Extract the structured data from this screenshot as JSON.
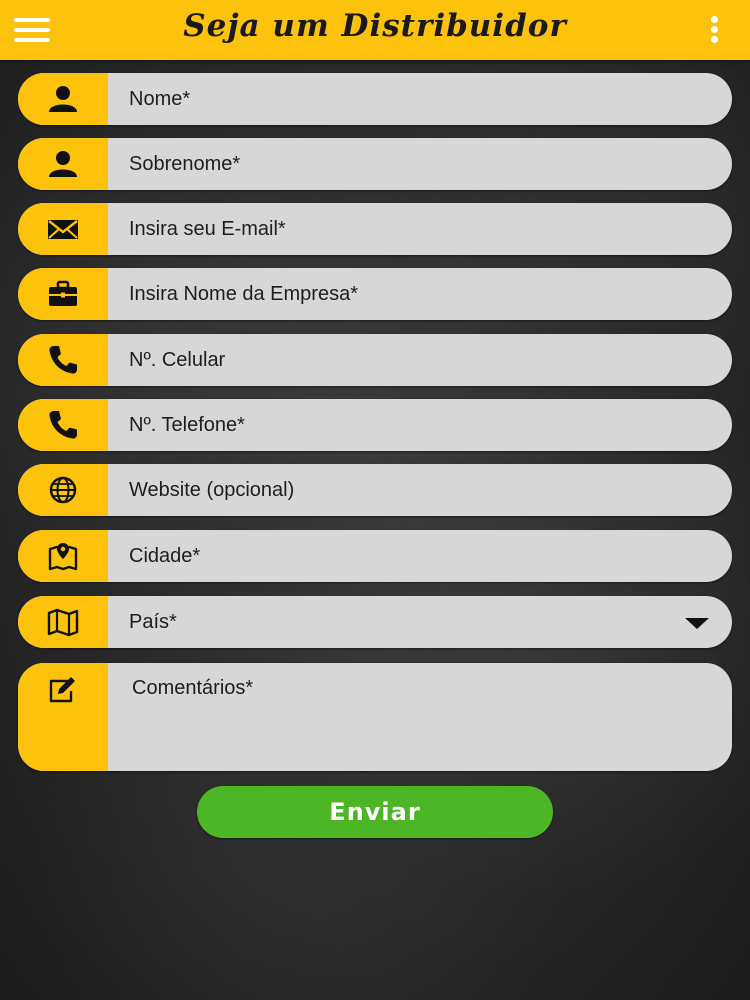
{
  "header": {
    "title": "Seja um Distribuidor",
    "menu_icon": "hamburger-menu-icon",
    "more_icon": "more-vertical-icon",
    "accent_color": "#fdc20c"
  },
  "form": {
    "fields": [
      {
        "id": "nome",
        "icon": "user-icon",
        "placeholder": "Nome*",
        "value": ""
      },
      {
        "id": "sobrenome",
        "icon": "user-icon",
        "placeholder": "Sobrenome*",
        "value": ""
      },
      {
        "id": "email",
        "icon": "envelope-icon",
        "placeholder": "Insira seu E-mail*",
        "value": ""
      },
      {
        "id": "empresa",
        "icon": "briefcase-icon",
        "placeholder": "Insira Nome da Empresa*",
        "value": ""
      },
      {
        "id": "celular",
        "icon": "phone-icon",
        "placeholder": "Nº. Celular",
        "value": ""
      },
      {
        "id": "telefone",
        "icon": "phone-icon",
        "placeholder": "Nº. Telefone*",
        "value": ""
      },
      {
        "id": "website",
        "icon": "globe-icon",
        "placeholder": "Website (opcional)",
        "value": ""
      },
      {
        "id": "cidade",
        "icon": "map-pin-icon",
        "placeholder": "Cidade*",
        "value": ""
      }
    ],
    "pais": {
      "icon": "map-icon",
      "selected": "País*"
    },
    "comentarios": {
      "icon": "edit-icon",
      "placeholder": "Comentários*",
      "value": ""
    },
    "submit_label": "Enviar",
    "submit_color": "#4cb627"
  }
}
